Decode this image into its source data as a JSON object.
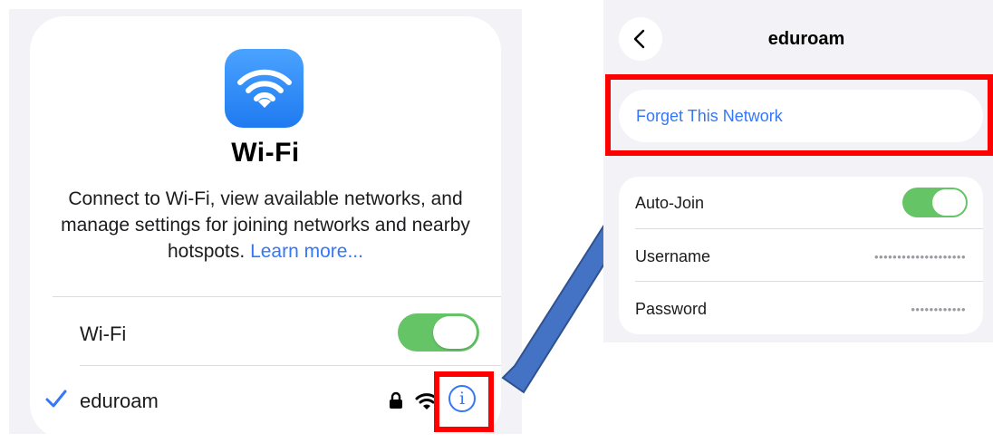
{
  "left": {
    "app_icon": "wifi-icon",
    "title": "Wi-Fi",
    "description": "Connect to Wi-Fi, view available networks, and manage settings for joining networks and nearby hotspots.",
    "learn_more": "Learn more...",
    "wifi_toggle": {
      "label": "Wi-Fi",
      "on": true
    },
    "network": {
      "name": "eduroam",
      "connected": true,
      "secured": true,
      "icons": [
        "checkmark-icon",
        "lock-icon",
        "wifi-signal-icon",
        "info-icon"
      ]
    }
  },
  "right": {
    "back_icon": "chevron-left-icon",
    "title": "eduroam",
    "forget": "Forget This Network",
    "auto_join": {
      "label": "Auto-Join",
      "on": true
    },
    "username": {
      "label": "Username",
      "value": "••••••••••••••••••••"
    },
    "password": {
      "label": "Password",
      "value": "••••••••••••"
    }
  },
  "colors": {
    "accent_blue": "#3478f6",
    "toggle_green": "#65c466",
    "highlight_red": "#ff0000",
    "arrow_blue": "#4472c4"
  }
}
